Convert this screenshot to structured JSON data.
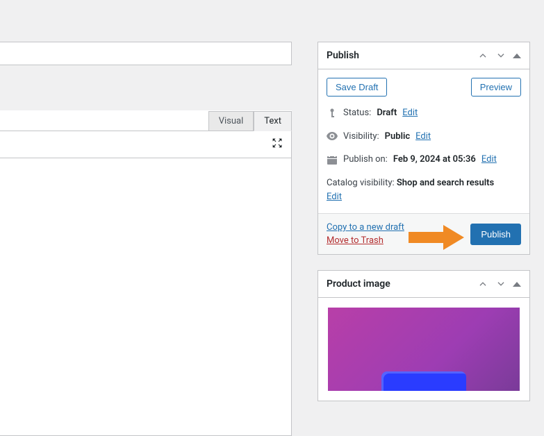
{
  "editor": {
    "tabs": {
      "visual": "Visual",
      "text": "Text"
    }
  },
  "publish": {
    "title": "Publish",
    "save_draft": "Save Draft",
    "preview": "Preview",
    "status_label": "Status:",
    "status_value": "Draft",
    "visibility_label": "Visibility:",
    "visibility_value": "Public",
    "publish_on_label": "Publish on:",
    "publish_on_value": "Feb 9, 2024 at 05:36",
    "catalog_label": "Catalog visibility:",
    "catalog_value": "Shop and search results",
    "edit": "Edit",
    "copy_draft": "Copy to a new draft",
    "move_trash": "Move to Trash",
    "publish_btn": "Publish"
  },
  "product_image": {
    "title": "Product image"
  }
}
